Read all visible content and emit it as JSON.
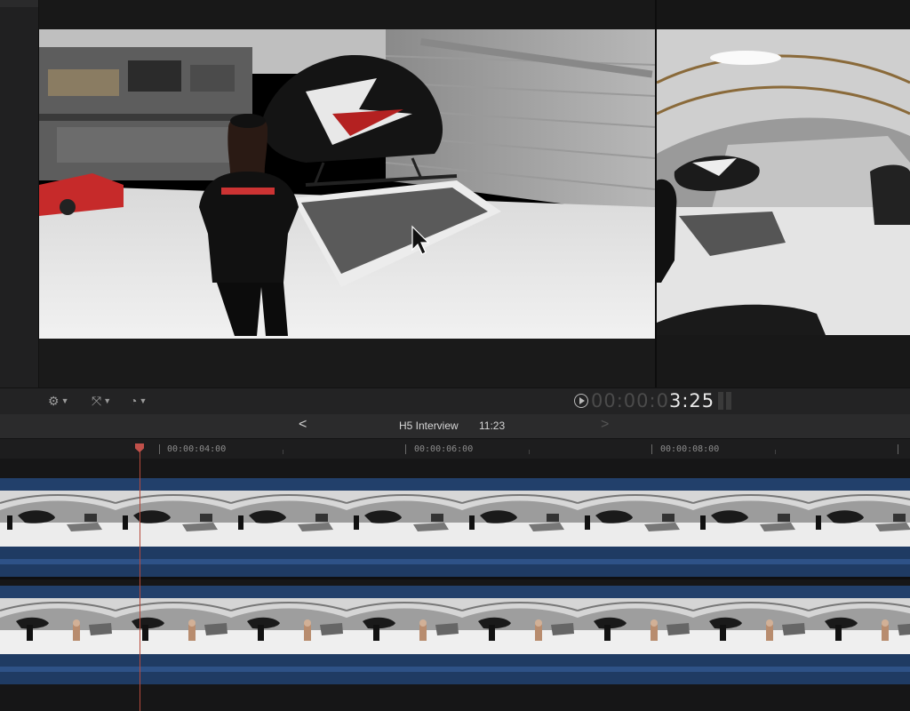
{
  "viewer": {
    "toolbar_icons": [
      "view-options-icon",
      "transform-icon",
      "speed-icon"
    ]
  },
  "transport": {
    "timecode_dim": "00:00:0",
    "timecode_lit": "3:25"
  },
  "timeline": {
    "back_label": "<",
    "forward_label": ">",
    "project_name": "H5 Interview",
    "duration": "11:23",
    "ruler_labels": [
      "00:00:04:00",
      "00:00:06:00",
      "00:00:08:00"
    ]
  },
  "colors": {
    "clip_blue": "#22406b",
    "audio_blue": "#1f3b63",
    "playhead": "#b64a3c"
  }
}
